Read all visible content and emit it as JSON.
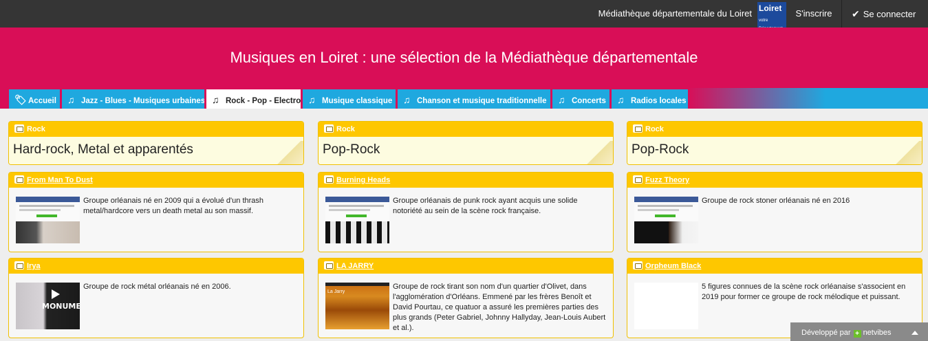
{
  "topbar": {
    "site_name": "Médiathèque départementale du Loiret",
    "logo_text": "Loiret",
    "logo_sub": "votre Département",
    "signup": "S'inscrire",
    "login": "Se connecter"
  },
  "header": {
    "title": "Musiques en Loiret : une sélection de la Médiathèque départementale"
  },
  "tabs": [
    {
      "label": "Accueil",
      "icon": "tag-icon"
    },
    {
      "label": "Jazz - Blues - Musiques urbaines",
      "icon": "music-note-icon"
    },
    {
      "label": "Rock - Pop - Electro",
      "icon": "music-note-icon",
      "active": true
    },
    {
      "label": "Musique classique",
      "icon": "music-note-icon"
    },
    {
      "label": "Chanson et musique traditionnelle",
      "icon": "music-note-icon"
    },
    {
      "label": "Concerts",
      "icon": "music-note-icon"
    },
    {
      "label": "Radios locales",
      "icon": "music-note-icon"
    }
  ],
  "columns": [
    {
      "title_card": {
        "header": "Rock",
        "title": "Hard-rock, Metal et apparentés"
      },
      "feeds": [
        {
          "title": "From Man To Dust",
          "text": "Groupe orléanais né en 2009 qui a évolué d'un thrash metal/hardcore vers un death metal au son massif."
        },
        {
          "title": "Irya",
          "text": "Groupe de rock métal orléanais né en 2006.",
          "thumb_text": "MONUMENT"
        }
      ]
    },
    {
      "title_card": {
        "header": "Rock",
        "title": "Pop-Rock"
      },
      "feeds": [
        {
          "title": "Burning Heads",
          "text": "Groupe orléanais de punk rock ayant acquis une solide notoriété au sein de la scène rock française."
        },
        {
          "title": "LA JARRY",
          "text": "Groupe de rock tirant son nom d'un quartier d'Olivet, dans l'agglomération d'Orléans. Emmené par les frères Benoît et David Pourtau, ce quatuor a assuré les premières parties des plus grands (Peter Gabriel, Johnny Hallyday, Jean-Louis Aubert et al.).",
          "thumb_text": "La Jarry"
        }
      ]
    },
    {
      "title_card": {
        "header": "Rock",
        "title": "Pop-Rock"
      },
      "feeds": [
        {
          "title": "Fuzz Theory",
          "text": "Groupe de rock stoner orléanais né en 2016"
        },
        {
          "title": "Orpheum Black",
          "text": "5 figures connues de la scène rock orléanaise s'associent en 2019 pour former ce groupe de rock mélodique et puissant."
        }
      ]
    }
  ],
  "footer": {
    "powered_by": "Développé par",
    "brand": "netvibes"
  },
  "colors": {
    "header_bg": "#d90e57",
    "tab_bg": "#1fa8df",
    "card_header": "#fec700",
    "topbar_bg": "#353535"
  }
}
